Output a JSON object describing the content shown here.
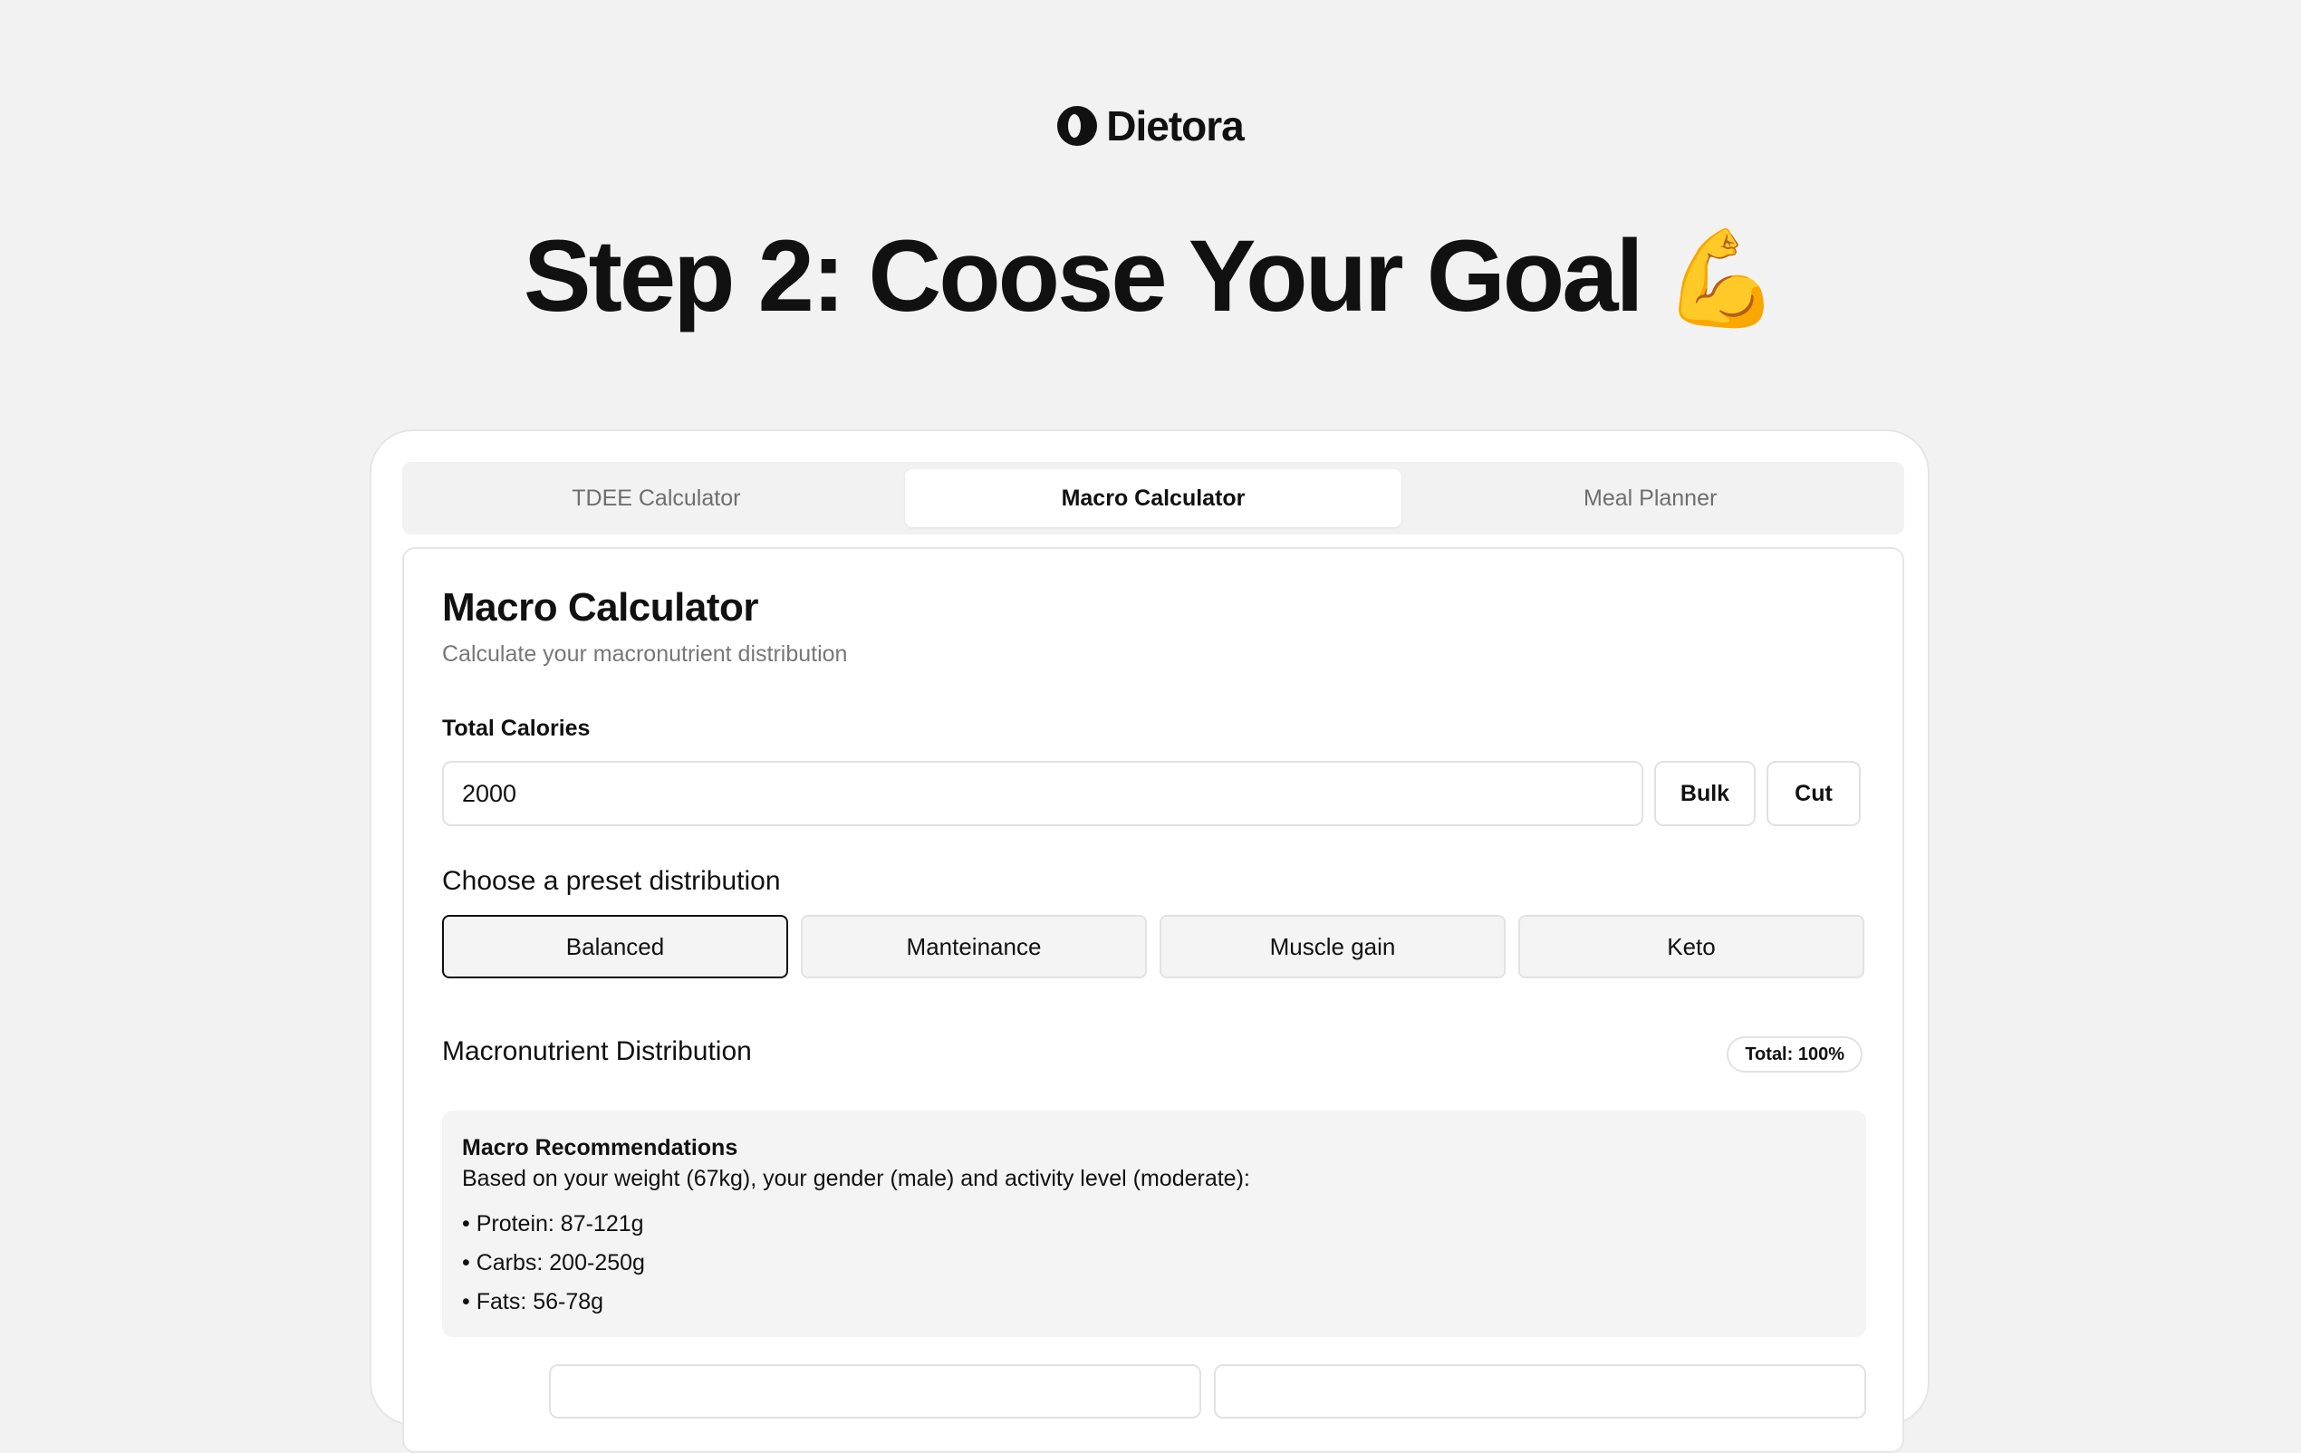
{
  "brand": {
    "name": "Dietora",
    "logo_icon": "dietora-logo-icon"
  },
  "hero": {
    "title": "Step 2: Coose Your Goal",
    "emoji": "💪"
  },
  "tabs": [
    {
      "label": "TDEE Calculator",
      "active": false
    },
    {
      "label": "Macro Calculator",
      "active": true
    },
    {
      "label": "Meal Planner",
      "active": false
    }
  ],
  "panel": {
    "title": "Macro Calculator",
    "subtitle": "Calculate your macronutrient distribution",
    "calories_label": "Total Calories",
    "calories_value": "2000",
    "bulk_label": "Bulk",
    "cut_label": "Cut",
    "preset_label": "Choose a preset distribution",
    "presets": [
      "Balanced",
      "Manteinance",
      "Muscle gain",
      "Keto"
    ],
    "selected_preset": "Balanced",
    "distribution_label": "Macronutrient Distribution",
    "total_badge": "Total: 100%",
    "recommendations": {
      "title": "Macro Recommendations",
      "description": "Based on your weight (67kg), your gender (male) and activity level (moderate):",
      "items": [
        "• Protein: 87-121g",
        "• Carbs: 200-250g",
        "• Fats: 56-78g"
      ]
    }
  },
  "colors": {
    "background": "#f2f2f2",
    "card": "#ffffff",
    "accent": "#111111",
    "muted": "#777777"
  }
}
